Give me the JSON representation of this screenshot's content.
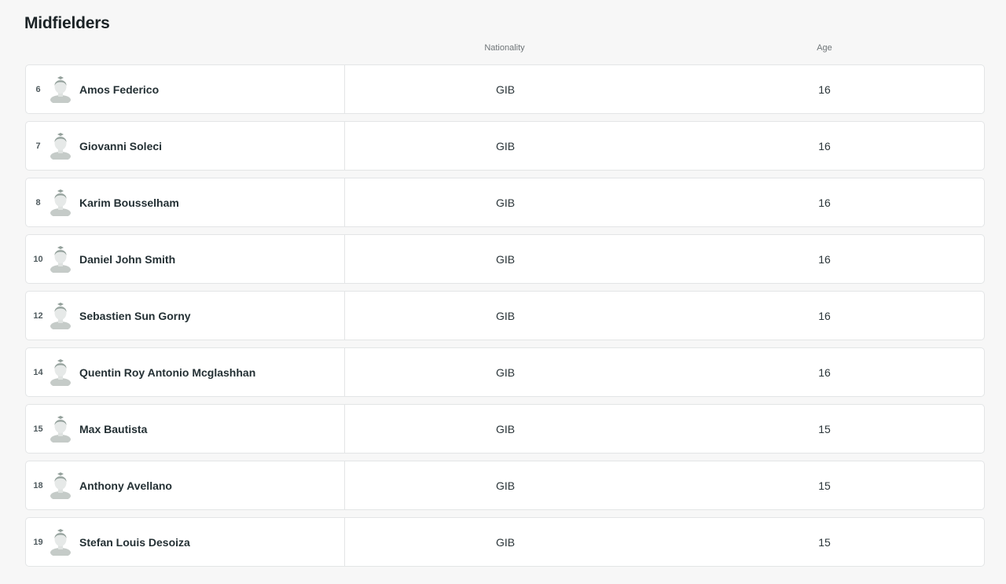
{
  "section": {
    "title": "Midfielders",
    "columns": {
      "nationality": "Nationality",
      "age": "Age"
    }
  },
  "players": [
    {
      "number": "6",
      "name": "Amos Federico",
      "nationality": "GIB",
      "age": "16",
      "avatar_icon": "player-silhouette-icon"
    },
    {
      "number": "7",
      "name": "Giovanni Soleci",
      "nationality": "GIB",
      "age": "16",
      "avatar_icon": "player-silhouette-icon"
    },
    {
      "number": "8",
      "name": "Karim Bousselham",
      "nationality": "GIB",
      "age": "16",
      "avatar_icon": "player-silhouette-icon"
    },
    {
      "number": "10",
      "name": "Daniel John Smith",
      "nationality": "GIB",
      "age": "16",
      "avatar_icon": "player-silhouette-icon"
    },
    {
      "number": "12",
      "name": "Sebastien Sun Gorny",
      "nationality": "GIB",
      "age": "16",
      "avatar_icon": "player-silhouette-icon"
    },
    {
      "number": "14",
      "name": "Quentin Roy Antonio Mcglashhan",
      "nationality": "GIB",
      "age": "16",
      "avatar_icon": "player-silhouette-icon"
    },
    {
      "number": "15",
      "name": "Max Bautista",
      "nationality": "GIB",
      "age": "15",
      "avatar_icon": "player-silhouette-icon"
    },
    {
      "number": "18",
      "name": "Anthony Avellano",
      "nationality": "GIB",
      "age": "15",
      "avatar_icon": "player-silhouette-icon"
    },
    {
      "number": "19",
      "name": "Stefan Louis Desoiza",
      "nationality": "GIB",
      "age": "15",
      "avatar_icon": "player-silhouette-icon"
    }
  ],
  "colors": {
    "background": "#f7f7f7",
    "row_background": "#ffffff",
    "row_border": "#e3e5e6",
    "avatar_hair": "#93a09b",
    "avatar_body": "#c5cbc8"
  }
}
